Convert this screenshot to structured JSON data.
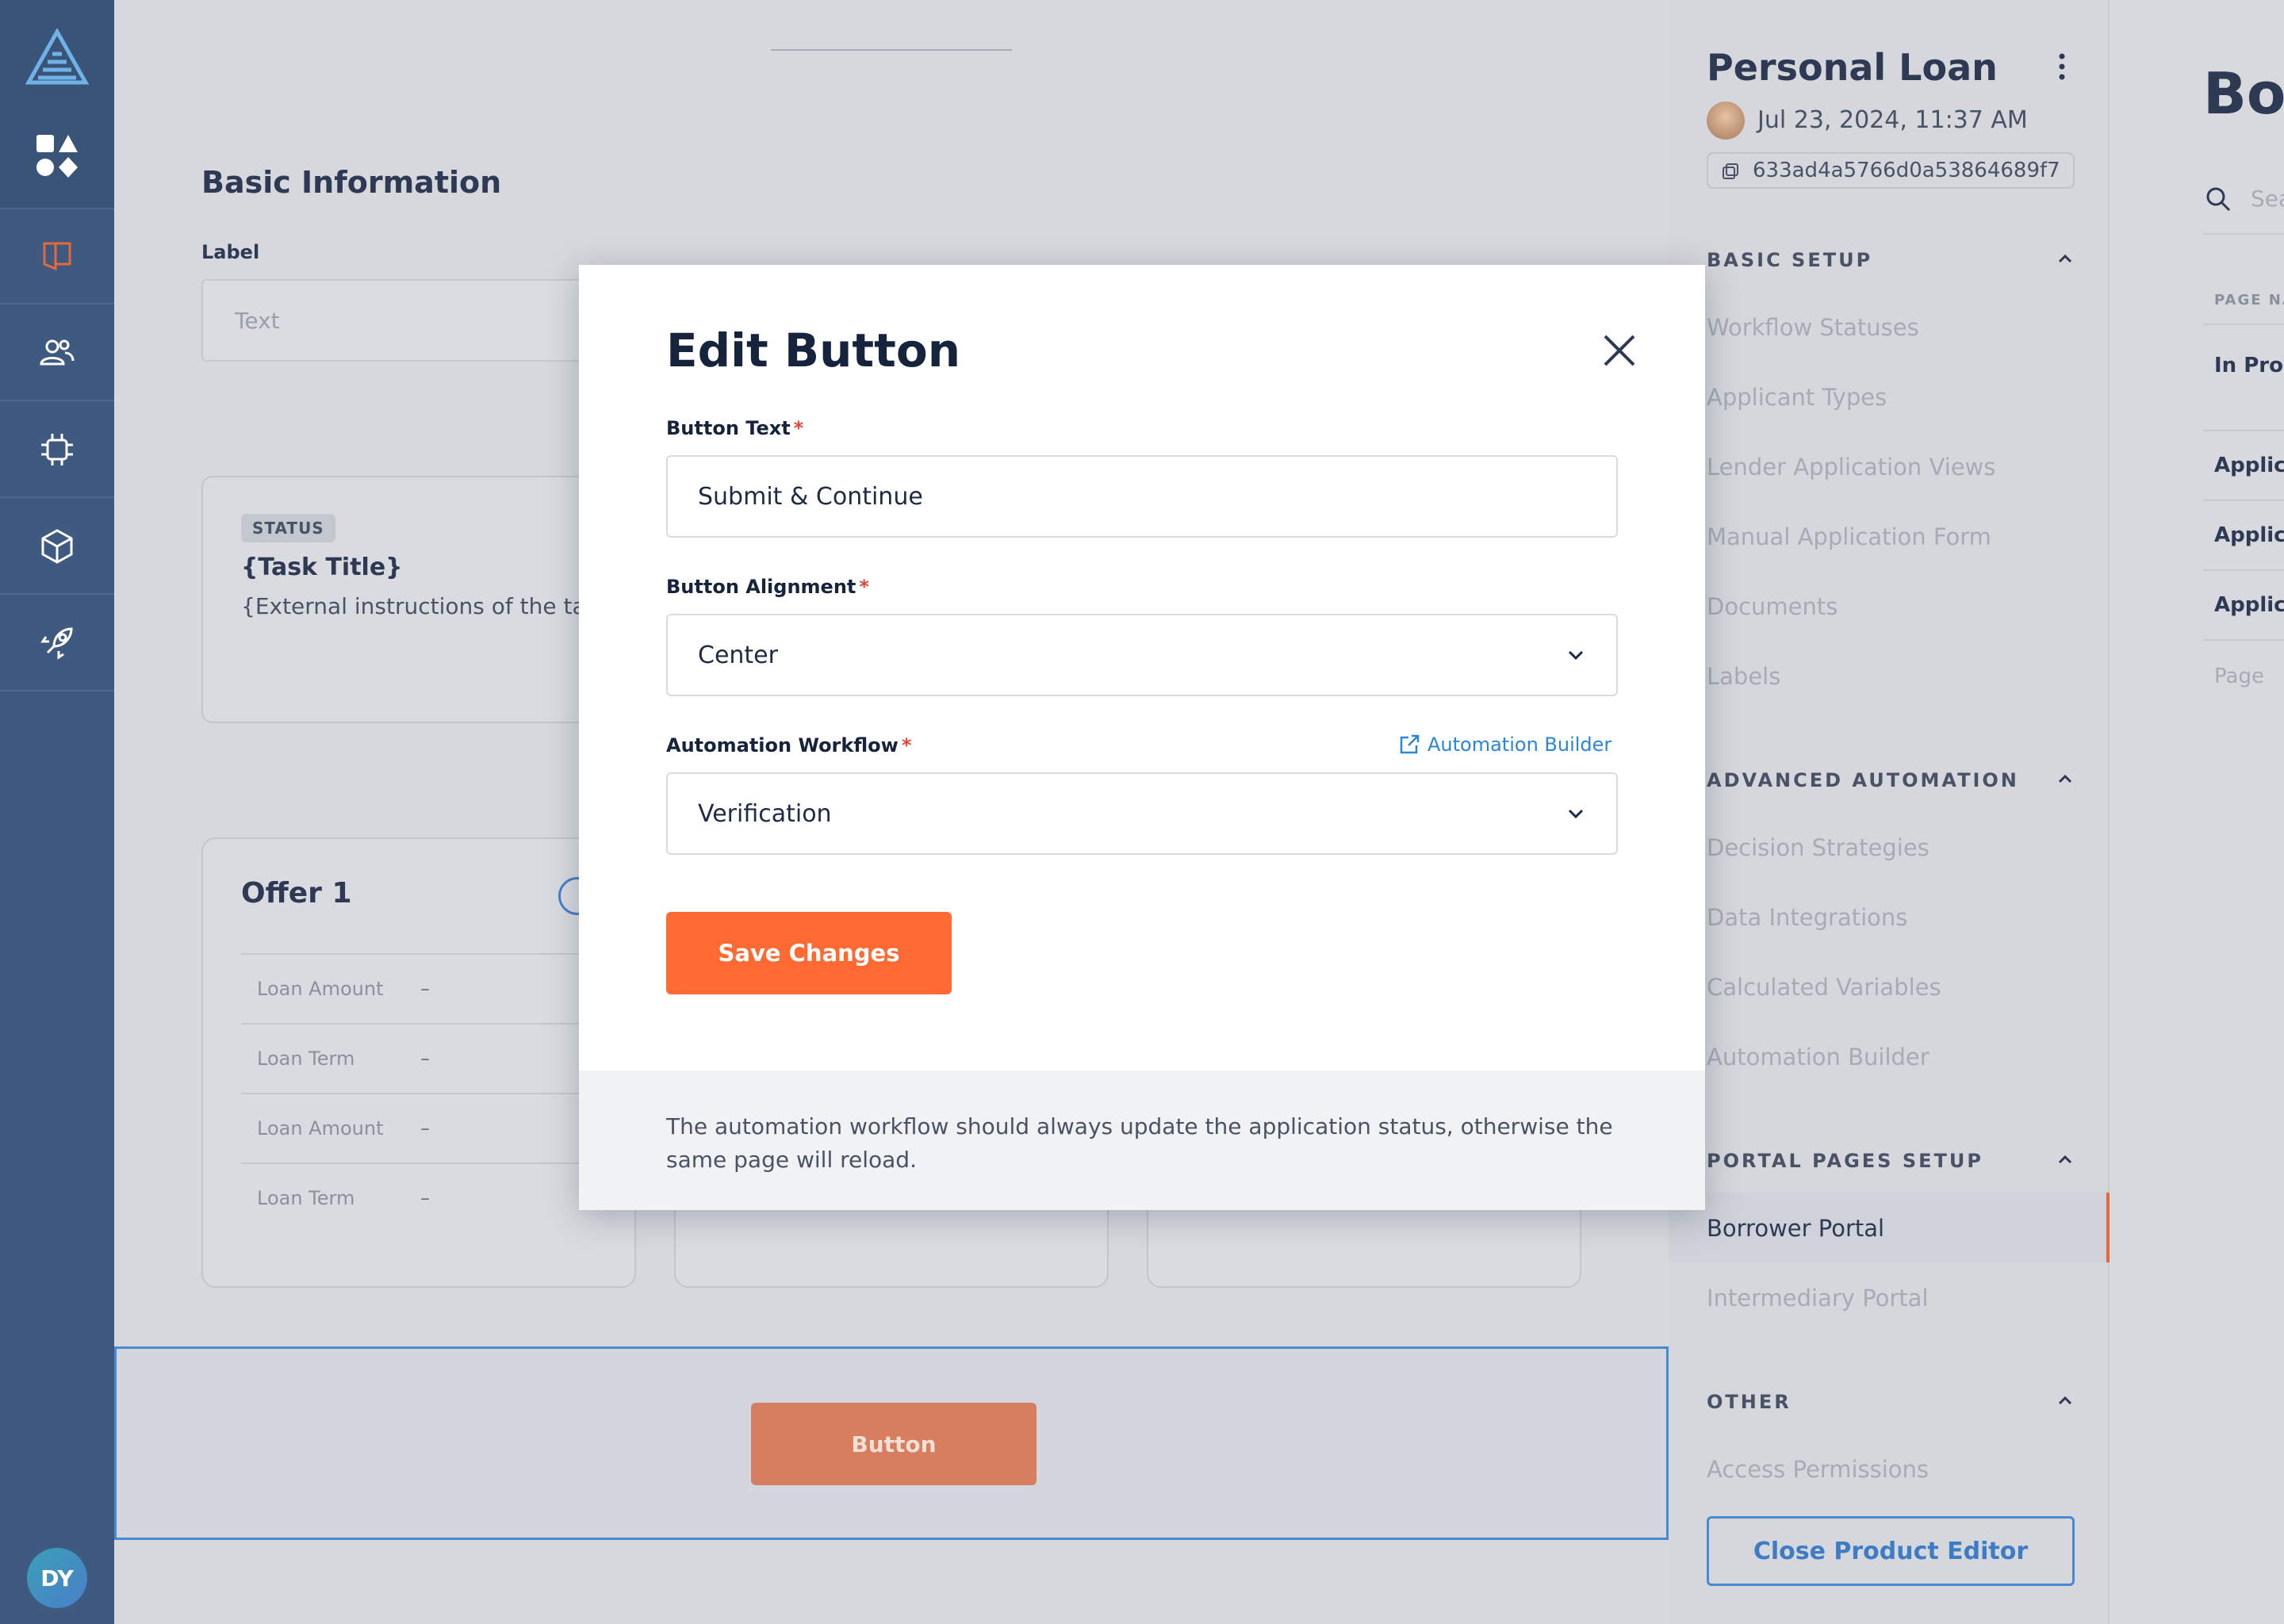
{
  "leftnav": {
    "logo_icon": "product-logo-icon",
    "apps_icon": "apps-grid-icon",
    "items": [
      {
        "name": "book-icon",
        "color": "#e36a3d"
      },
      {
        "name": "users-icon",
        "color": "#ffffff"
      },
      {
        "name": "chip-icon",
        "color": "#ffffff"
      },
      {
        "name": "cube-icon",
        "color": "#ffffff"
      },
      {
        "name": "rocket-icon",
        "color": "#ffffff"
      }
    ],
    "user_initials": "DY"
  },
  "main": {
    "section_title": "Basic Information",
    "label_field_label": "Label",
    "label_field_placeholder": "Text",
    "task_card": {
      "status_badge": "STATUS",
      "title": "{Task Title}",
      "description": "{External instructions of the task}"
    },
    "offers": [
      {
        "title": "Offer 1",
        "rows": [
          {
            "label": "Loan Amount",
            "value": "–"
          },
          {
            "label": "Loan Term",
            "value": "–"
          },
          {
            "label": "Loan Amount",
            "value": "–"
          },
          {
            "label": "Loan Term",
            "value": "–"
          }
        ]
      }
    ],
    "preview_button_label": "Button"
  },
  "right_panel": {
    "title": "Personal Loan",
    "date": "Jul 23, 2024, 11:37 AM",
    "id": "633ad4a5766d0a53864689f7",
    "groups": [
      {
        "heading": "BASIC SETUP",
        "items": [
          "Workflow Statuses",
          "Applicant Types",
          "Lender Application Views",
          "Manual Application Form",
          "Documents",
          "Labels"
        ]
      },
      {
        "heading": "ADVANCED AUTOMATION",
        "items": [
          "Decision Strategies",
          "Data Integrations",
          "Calculated Variables",
          "Automation Builder"
        ]
      },
      {
        "heading": "PORTAL PAGES SETUP",
        "items": [
          "Borrower Portal",
          "Intermediary Portal"
        ]
      },
      {
        "heading": "OTHER",
        "items": [
          "Access Permissions"
        ]
      }
    ],
    "active_item": "Borrower Portal",
    "close_button": "Close Product Editor"
  },
  "far_panel": {
    "title": "Bo",
    "search_placeholder": "Sea",
    "column_header": "PAGE NA",
    "rows": [
      "In Prog",
      "Applica",
      "Applica",
      "Applica"
    ],
    "footer_text": "Page"
  },
  "modal": {
    "title": "Edit Button",
    "button_text_label": "Button Text",
    "button_text_value": "Submit & Continue",
    "alignment_label": "Button Alignment",
    "alignment_value": "Center",
    "workflow_label": "Automation Workflow",
    "workflow_value": "Verification",
    "builder_link": "Automation Builder",
    "required_mark": "*",
    "save_button": "Save Changes",
    "footer_note": "The automation workflow should always update the application status, otherwise the same page will reload."
  },
  "colors": {
    "nav_bg": "#3e5a80",
    "accent_orange": "#ff6a33",
    "link_blue": "#2a86d8",
    "selection_blue": "#4a8ad4"
  }
}
